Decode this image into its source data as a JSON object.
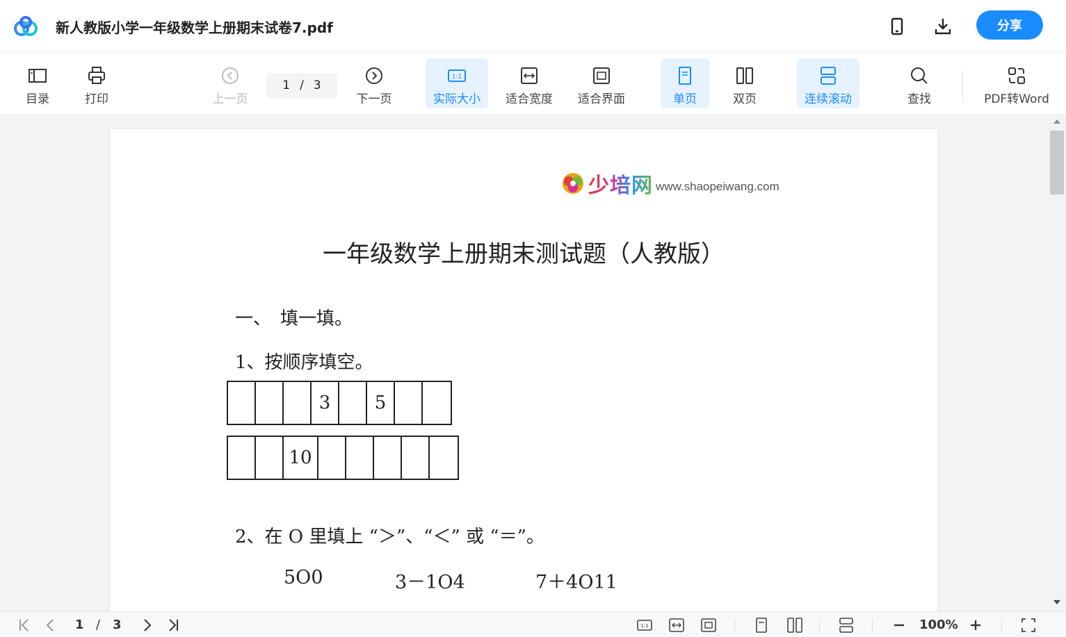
{
  "header": {
    "file_title": "新人教版小学一年级数学上册期末试卷7.pdf",
    "share_label": "分享",
    "icons": [
      "baidu-cloud-logo",
      "phone-icon",
      "download-icon"
    ]
  },
  "toolbar": {
    "toc_label": "目录",
    "print_label": "打印",
    "prev_label": "上一页",
    "current_page": "1",
    "page_separator": "/",
    "total_pages": "3",
    "next_label": "下一页",
    "actual_size_label": "实际大小",
    "fit_width_label": "适合宽度",
    "fit_page_label": "适合界面",
    "single_page_label": "单页",
    "double_page_label": "双页",
    "continuous_label": "连续滚动",
    "search_label": "查找",
    "pdf_to_word_label": "PDF转Word"
  },
  "document": {
    "brand_name": "少培网",
    "brand_url": "www.shaopeiwang.com",
    "title": "一年级数学上册期末测试题（人教版）",
    "section1": "一、　填一填。",
    "question1": "1、按顺序填空。",
    "row1_cells": [
      "",
      "",
      "",
      "3",
      "",
      "5",
      "",
      ""
    ],
    "row2_cells": [
      "",
      "",
      "10",
      "",
      "",
      "",
      "",
      ""
    ],
    "question2": "2、在 O 里填上 “＞”、“＜” 或 “＝”。",
    "expr1": "5O0",
    "expr2": "3－1O4",
    "expr3": "7＋4O11"
  },
  "statusbar": {
    "current_page": "1",
    "page_separator": "/",
    "total_pages": "3",
    "zoom": "100%"
  },
  "colors": {
    "accent": "#1a8cff",
    "active_bg": "#e6f2ff",
    "viewer_bg": "#f2f3f5"
  }
}
